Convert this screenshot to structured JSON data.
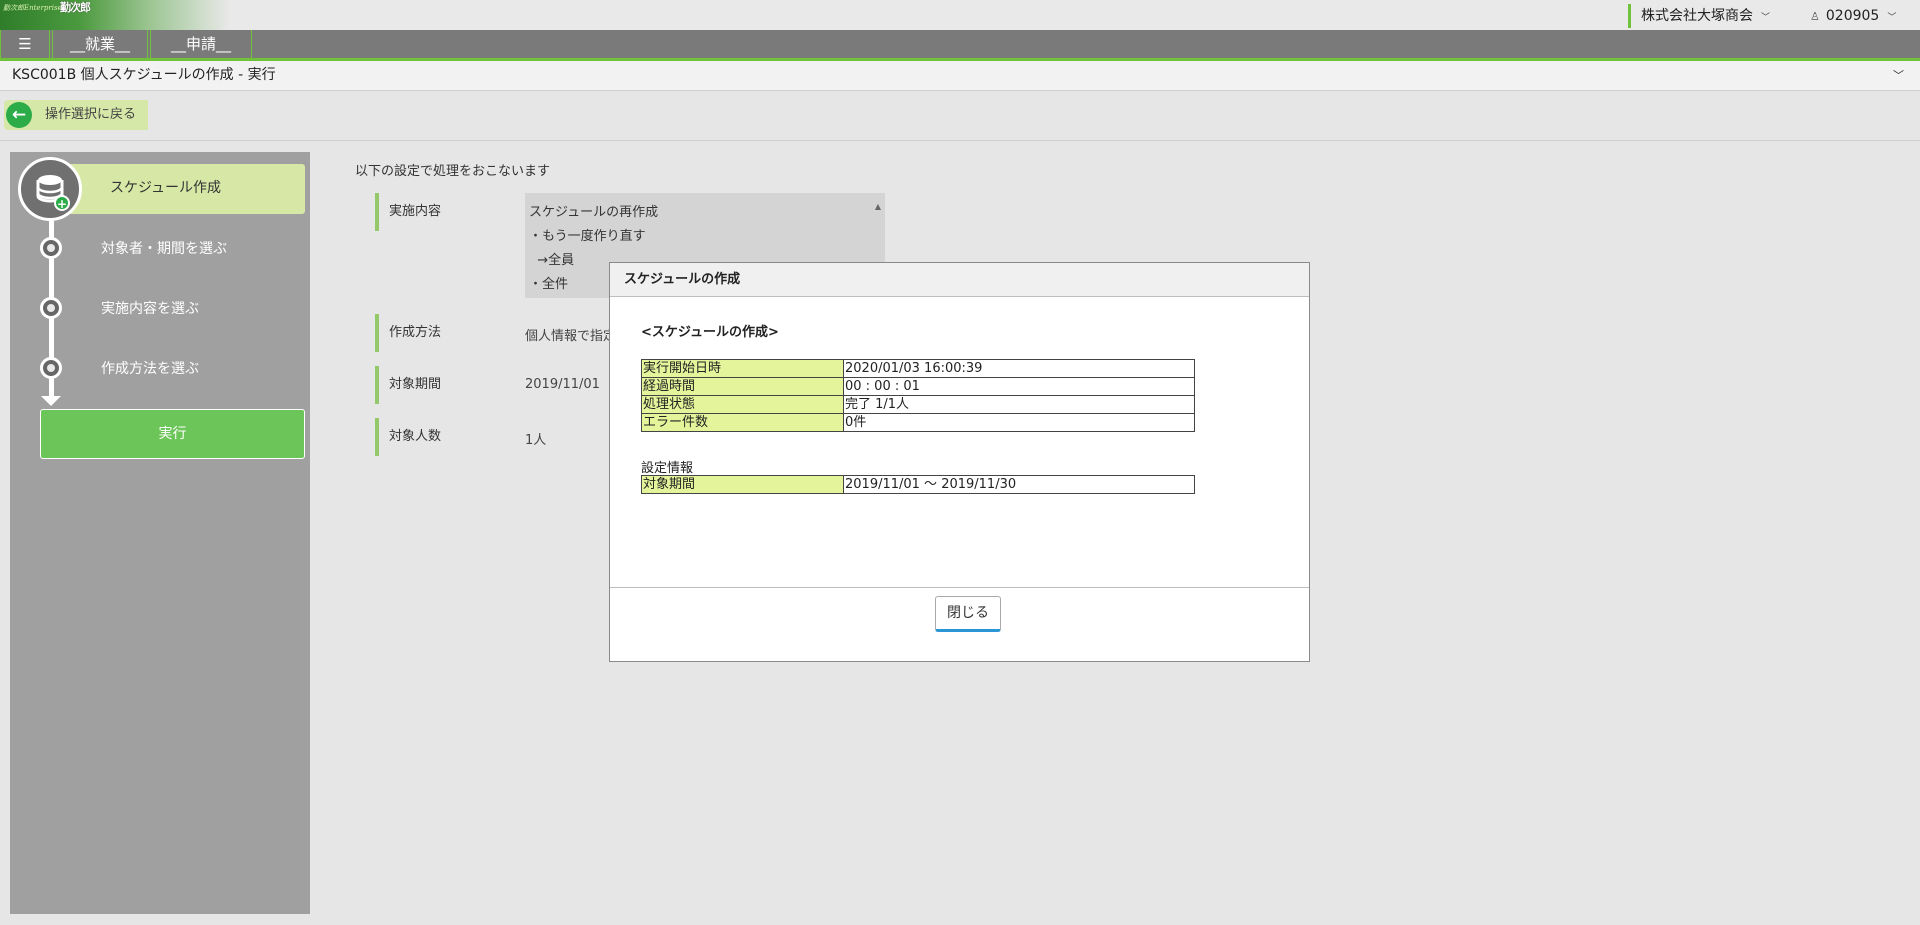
{
  "header": {
    "logo_small": "勤次郎Enterprise",
    "logo_mark": "勤次郎",
    "company": "株式会社大塚商会",
    "user_id": "020905"
  },
  "nav": {
    "menu_icon": "☰",
    "items": [
      {
        "label": "__就業__"
      },
      {
        "label": "__申請__"
      }
    ]
  },
  "titlebar": {
    "title": "KSC001B 個人スケジュールの作成 - 実行"
  },
  "back_button": {
    "label": "操作選択に戻る"
  },
  "steps": [
    {
      "label": "スケジュール作成",
      "active": true
    },
    {
      "label": "対象者・期間を選ぶ"
    },
    {
      "label": "実施内容を選ぶ"
    },
    {
      "label": "作成方法を選ぶ"
    },
    {
      "label": "実行"
    }
  ],
  "main": {
    "intro": "以下の設定で処理をおこないます",
    "fields": [
      {
        "label": "実施内容"
      },
      {
        "label": "作成方法",
        "value": "個人情報で指定"
      },
      {
        "label": "対象期間",
        "value": "2019/11/01"
      },
      {
        "label": "対象人数",
        "value": "1人"
      }
    ],
    "content_lines": [
      "スケジュールの再作成",
      "・もう一度作り直す",
      "  →全員",
      "・全件"
    ]
  },
  "modal": {
    "title": "スケジュールの作成",
    "subtitle": "<スケジュールの作成>",
    "status_rows": [
      {
        "key": "実行開始日時",
        "value": "2020/01/03 16:00:39"
      },
      {
        "key": "経過時間",
        "value": "00 : 00 : 01"
      },
      {
        "key": "処理状態",
        "value": "完了 1/1人"
      },
      {
        "key": "エラー件数",
        "value": "0件"
      }
    ],
    "settings_heading": "設定情報",
    "settings_rows": [
      {
        "key": "対象期間",
        "value": "2019/11/01 〜 2019/11/30"
      }
    ],
    "close_label": "閉じる"
  },
  "colors": {
    "accent_green": "#6fc23a",
    "active_step_bg": "#d7e8a6",
    "exec_button": "#6cc559",
    "table_key_bg": "#e3f49b",
    "close_button_underline": "#2a96d6"
  }
}
